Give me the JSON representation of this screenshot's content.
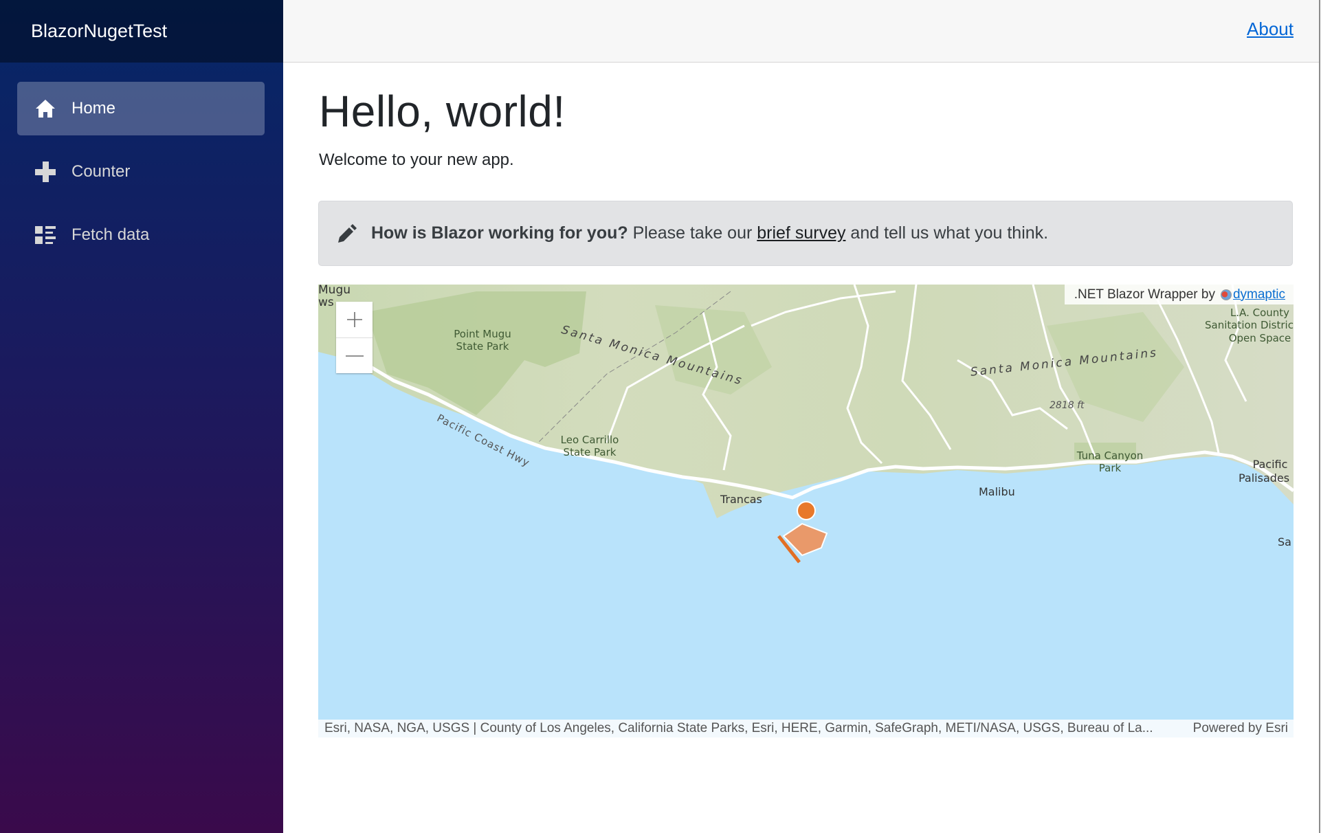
{
  "sidebar": {
    "brand": "BlazorNugetTest",
    "items": [
      {
        "label": "Home",
        "icon": "home-icon",
        "active": true
      },
      {
        "label": "Counter",
        "icon": "plus-icon",
        "active": false
      },
      {
        "label": "Fetch data",
        "icon": "list-rich-icon",
        "active": false
      }
    ]
  },
  "topbar": {
    "about_label": "About"
  },
  "main": {
    "title": "Hello, world!",
    "welcome": "Welcome to your new app.",
    "survey": {
      "icon": "pencil-icon",
      "question": "How is Blazor working for you?",
      "before_link": " Please take our ",
      "link_text": "brief survey",
      "after_link": " and tell us what you think."
    }
  },
  "map": {
    "zoom_in_label": "+",
    "zoom_out_label": "—",
    "credit_prefix": ".NET Blazor Wrapper by ",
    "credit_link": "dymaptic",
    "attribution": "Esri, NASA, NGA, USGS | County of Los Angeles, California State Parks, Esri, HERE, Garmin, SafeGraph, METI/NASA, USGS, Bureau of La...",
    "powered_by": "Powered by Esri",
    "labels": {
      "mugu": "Mugu",
      "ws": "ws",
      "point_mugu_1": "Point Mugu",
      "point_mugu_2": "State Park",
      "smm_west": "Santa Monica Mountains",
      "smm_east": "Santa Monica Mountains",
      "pch": "Pacific Coast Hwy",
      "leo_1": "Leo Carrillo",
      "leo_2": "State Park",
      "trancas": "Trancas",
      "malibu": "Malibu",
      "elev": "2818 ft",
      "tuna_1": "Tuna Canyon",
      "tuna_2": "Park",
      "la_1": "L.A. County",
      "la_2": "Sanitation Distric",
      "la_3": "Open Space",
      "pp_1": "Pacific",
      "pp_2": "Palisades",
      "sa": "Sa"
    },
    "colors": {
      "water": "#b9e3fb",
      "land": "#dfe6cf",
      "marker": "#e8792a",
      "polygon_fill": "#e9996a"
    }
  }
}
